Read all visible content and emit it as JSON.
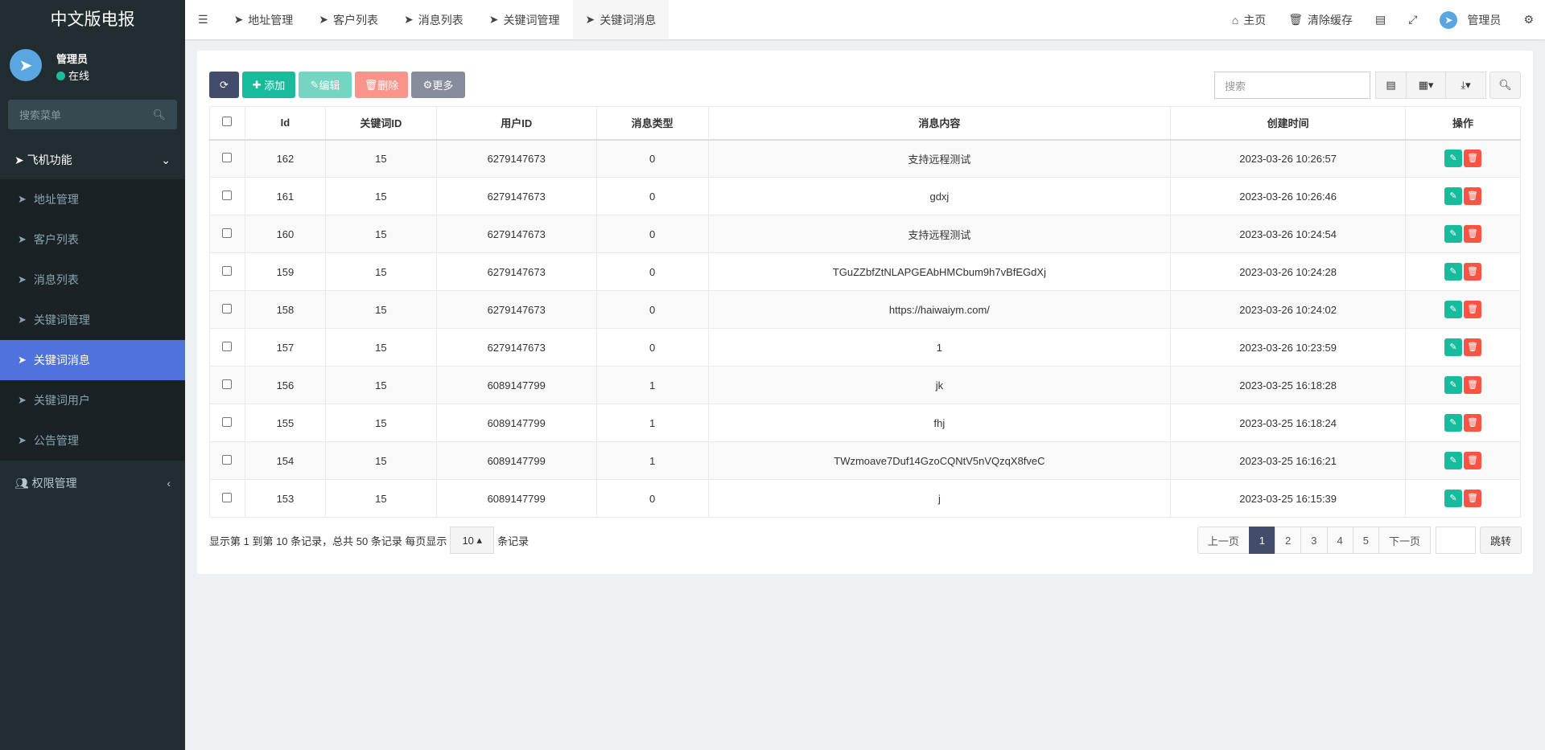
{
  "app": {
    "title": "中文版电报"
  },
  "user": {
    "name": "管理员",
    "status": "在线"
  },
  "sidebar": {
    "search_placeholder": "搜索菜单",
    "group": "飞机功能",
    "items": [
      {
        "label": "地址管理"
      },
      {
        "label": "客户列表"
      },
      {
        "label": "消息列表"
      },
      {
        "label": "关键词管理"
      },
      {
        "label": "关键词消息",
        "active": true
      },
      {
        "label": "关键词用户"
      },
      {
        "label": "公告管理"
      }
    ],
    "group2": "权限管理"
  },
  "topnav": {
    "tabs": [
      {
        "label": "地址管理"
      },
      {
        "label": "客户列表"
      },
      {
        "label": "消息列表"
      },
      {
        "label": "关键词管理"
      },
      {
        "label": "关键词消息",
        "active": true
      }
    ],
    "home": "主页",
    "clear_cache": "清除缓存",
    "admin": "管理员"
  },
  "toolbar": {
    "add": "添加",
    "edit": "编辑",
    "delete": "删除",
    "more": "更多",
    "search_placeholder": "搜索"
  },
  "table": {
    "headers": [
      "Id",
      "关键词ID",
      "用户ID",
      "消息类型",
      "消息内容",
      "创建时间",
      "操作"
    ],
    "rows": [
      [
        "162",
        "15",
        "6279147673",
        "0",
        "支持远程测试",
        "2023-03-26 10:26:57"
      ],
      [
        "161",
        "15",
        "6279147673",
        "0",
        "gdxj",
        "2023-03-26 10:26:46"
      ],
      [
        "160",
        "15",
        "6279147673",
        "0",
        "支持远程测试",
        "2023-03-26 10:24:54"
      ],
      [
        "159",
        "15",
        "6279147673",
        "0",
        "TGuZZbfZtNLAPGEAbHMCbum9h7vBfEGdXj",
        "2023-03-26 10:24:28"
      ],
      [
        "158",
        "15",
        "6279147673",
        "0",
        "https://haiwaiym.com/",
        "2023-03-26 10:24:02"
      ],
      [
        "157",
        "15",
        "6279147673",
        "0",
        "1",
        "2023-03-26 10:23:59"
      ],
      [
        "156",
        "15",
        "6089147799",
        "1",
        "jk",
        "2023-03-25 16:18:28"
      ],
      [
        "155",
        "15",
        "6089147799",
        "1",
        "fhj",
        "2023-03-25 16:18:24"
      ],
      [
        "154",
        "15",
        "6089147799",
        "1",
        "TWzmoave7Duf14GzoCQNtV5nVQzqX8fveC",
        "2023-03-25 16:16:21"
      ],
      [
        "153",
        "15",
        "6089147799",
        "0",
        "j",
        "2023-03-25 16:15:39"
      ]
    ]
  },
  "footer": {
    "info": "显示第 1 到第 10 条记录，总共 50 条记录 每页显示",
    "page_size": "10",
    "suffix": "条记录"
  },
  "pagination": {
    "prev": "上一页",
    "pages": [
      "1",
      "2",
      "3",
      "4",
      "5"
    ],
    "current": "1",
    "next": "下一页",
    "jump": "跳转"
  },
  "colors": {
    "sidebar": "#222d32",
    "active": "#5072dc",
    "success": "#18bc9c",
    "danger": "#f75444",
    "primary": "#444c6c"
  }
}
